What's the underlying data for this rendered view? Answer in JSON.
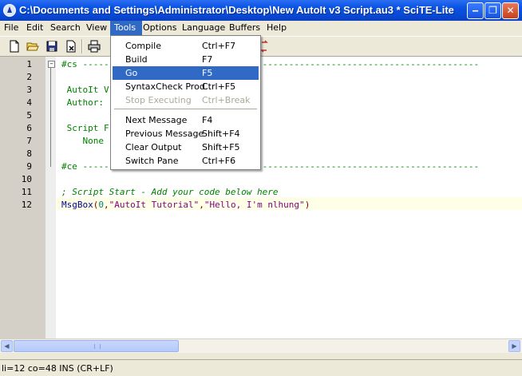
{
  "window": {
    "title": "C:\\Documents and Settings\\Administrator\\Desktop\\New AutoIt v3 Script.au3 * SciTE-Lite",
    "min_glyph": "‒",
    "max_glyph": "❐",
    "close_glyph": "✕"
  },
  "menubar": {
    "items": [
      "File",
      "Edit",
      "Search",
      "View",
      "Tools",
      "Options",
      "Language",
      "Buffers",
      "Help"
    ],
    "active": "Tools"
  },
  "toolbar": {
    "icons": [
      "new-file-icon",
      "open-folder-icon",
      "save-icon",
      "close-file-icon",
      "print-icon"
    ]
  },
  "tools_menu": {
    "items": [
      {
        "label": "Compile",
        "shortcut": "Ctrl+F7",
        "state": "normal"
      },
      {
        "label": "Build",
        "shortcut": "F7",
        "state": "normal"
      },
      {
        "label": "Go",
        "shortcut": "F5",
        "state": "selected"
      },
      {
        "label": "SyntaxCheck Prod",
        "shortcut": "Ctrl+F5",
        "state": "normal"
      },
      {
        "label": "Stop Executing",
        "shortcut": "Ctrl+Break",
        "state": "disabled"
      },
      {
        "label": "Next Message",
        "shortcut": "F4",
        "state": "normal"
      },
      {
        "label": "Previous Message",
        "shortcut": "Shift+F4",
        "state": "normal"
      },
      {
        "label": "Clear Output",
        "shortcut": "Shift+F5",
        "state": "normal"
      },
      {
        "label": "Switch Pane",
        "shortcut": "Ctrl+F6",
        "state": "normal"
      }
    ]
  },
  "editor": {
    "line_numbers": [
      "1",
      "2",
      "3",
      "4",
      "5",
      "6",
      "7",
      "8",
      "9",
      "10",
      "11",
      "12"
    ],
    "lines": {
      "l1": "#cs ---------------------------------------------------------------------------",
      "l3": " AutoIt V",
      "l4": " Author:",
      "l6": " Script F",
      "l7": "    None",
      "l9": "#ce ---------------------------------------------------------------------------",
      "l11": "; Script Start - Add your code below here",
      "l12_func": "MsgBox",
      "l12_open": "(",
      "l12_num": "0",
      "l12_comma1": ",",
      "l12_str1": "\"AutoIt Tutorial\"",
      "l12_comma2": ",",
      "l12_str2": "\"Hello, I'm nlhung\"",
      "l12_close": ")"
    },
    "current_line": "12"
  },
  "status": {
    "text": "li=12 co=48 INS (CR+LF)"
  },
  "colors": {
    "title_bar": "#0a54e4",
    "menu_highlight": "#316ac5",
    "comment": "#008000",
    "string": "#7f007f",
    "number": "#007f7f",
    "function": "#000090"
  }
}
